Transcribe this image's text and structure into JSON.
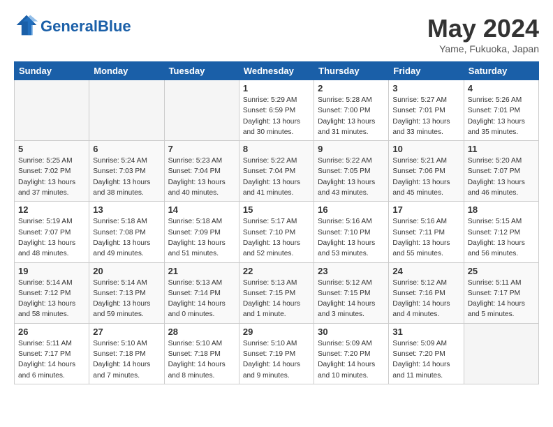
{
  "header": {
    "logo": {
      "general": "General",
      "blue": "Blue"
    },
    "title": "May 2024",
    "location": "Yame, Fukuoka, Japan"
  },
  "weekdays": [
    "Sunday",
    "Monday",
    "Tuesday",
    "Wednesday",
    "Thursday",
    "Friday",
    "Saturday"
  ],
  "weeks": [
    [
      {
        "day": "",
        "info": ""
      },
      {
        "day": "",
        "info": ""
      },
      {
        "day": "",
        "info": ""
      },
      {
        "day": "1",
        "info": "Sunrise: 5:29 AM\nSunset: 6:59 PM\nDaylight: 13 hours\nand 30 minutes."
      },
      {
        "day": "2",
        "info": "Sunrise: 5:28 AM\nSunset: 7:00 PM\nDaylight: 13 hours\nand 31 minutes."
      },
      {
        "day": "3",
        "info": "Sunrise: 5:27 AM\nSunset: 7:01 PM\nDaylight: 13 hours\nand 33 minutes."
      },
      {
        "day": "4",
        "info": "Sunrise: 5:26 AM\nSunset: 7:01 PM\nDaylight: 13 hours\nand 35 minutes."
      }
    ],
    [
      {
        "day": "5",
        "info": "Sunrise: 5:25 AM\nSunset: 7:02 PM\nDaylight: 13 hours\nand 37 minutes."
      },
      {
        "day": "6",
        "info": "Sunrise: 5:24 AM\nSunset: 7:03 PM\nDaylight: 13 hours\nand 38 minutes."
      },
      {
        "day": "7",
        "info": "Sunrise: 5:23 AM\nSunset: 7:04 PM\nDaylight: 13 hours\nand 40 minutes."
      },
      {
        "day": "8",
        "info": "Sunrise: 5:22 AM\nSunset: 7:04 PM\nDaylight: 13 hours\nand 41 minutes."
      },
      {
        "day": "9",
        "info": "Sunrise: 5:22 AM\nSunset: 7:05 PM\nDaylight: 13 hours\nand 43 minutes."
      },
      {
        "day": "10",
        "info": "Sunrise: 5:21 AM\nSunset: 7:06 PM\nDaylight: 13 hours\nand 45 minutes."
      },
      {
        "day": "11",
        "info": "Sunrise: 5:20 AM\nSunset: 7:07 PM\nDaylight: 13 hours\nand 46 minutes."
      }
    ],
    [
      {
        "day": "12",
        "info": "Sunrise: 5:19 AM\nSunset: 7:07 PM\nDaylight: 13 hours\nand 48 minutes."
      },
      {
        "day": "13",
        "info": "Sunrise: 5:18 AM\nSunset: 7:08 PM\nDaylight: 13 hours\nand 49 minutes."
      },
      {
        "day": "14",
        "info": "Sunrise: 5:18 AM\nSunset: 7:09 PM\nDaylight: 13 hours\nand 51 minutes."
      },
      {
        "day": "15",
        "info": "Sunrise: 5:17 AM\nSunset: 7:10 PM\nDaylight: 13 hours\nand 52 minutes."
      },
      {
        "day": "16",
        "info": "Sunrise: 5:16 AM\nSunset: 7:10 PM\nDaylight: 13 hours\nand 53 minutes."
      },
      {
        "day": "17",
        "info": "Sunrise: 5:16 AM\nSunset: 7:11 PM\nDaylight: 13 hours\nand 55 minutes."
      },
      {
        "day": "18",
        "info": "Sunrise: 5:15 AM\nSunset: 7:12 PM\nDaylight: 13 hours\nand 56 minutes."
      }
    ],
    [
      {
        "day": "19",
        "info": "Sunrise: 5:14 AM\nSunset: 7:12 PM\nDaylight: 13 hours\nand 58 minutes."
      },
      {
        "day": "20",
        "info": "Sunrise: 5:14 AM\nSunset: 7:13 PM\nDaylight: 13 hours\nand 59 minutes."
      },
      {
        "day": "21",
        "info": "Sunrise: 5:13 AM\nSunset: 7:14 PM\nDaylight: 14 hours\nand 0 minutes."
      },
      {
        "day": "22",
        "info": "Sunrise: 5:13 AM\nSunset: 7:15 PM\nDaylight: 14 hours\nand 1 minute."
      },
      {
        "day": "23",
        "info": "Sunrise: 5:12 AM\nSunset: 7:15 PM\nDaylight: 14 hours\nand 3 minutes."
      },
      {
        "day": "24",
        "info": "Sunrise: 5:12 AM\nSunset: 7:16 PM\nDaylight: 14 hours\nand 4 minutes."
      },
      {
        "day": "25",
        "info": "Sunrise: 5:11 AM\nSunset: 7:17 PM\nDaylight: 14 hours\nand 5 minutes."
      }
    ],
    [
      {
        "day": "26",
        "info": "Sunrise: 5:11 AM\nSunset: 7:17 PM\nDaylight: 14 hours\nand 6 minutes."
      },
      {
        "day": "27",
        "info": "Sunrise: 5:10 AM\nSunset: 7:18 PM\nDaylight: 14 hours\nand 7 minutes."
      },
      {
        "day": "28",
        "info": "Sunrise: 5:10 AM\nSunset: 7:18 PM\nDaylight: 14 hours\nand 8 minutes."
      },
      {
        "day": "29",
        "info": "Sunrise: 5:10 AM\nSunset: 7:19 PM\nDaylight: 14 hours\nand 9 minutes."
      },
      {
        "day": "30",
        "info": "Sunrise: 5:09 AM\nSunset: 7:20 PM\nDaylight: 14 hours\nand 10 minutes."
      },
      {
        "day": "31",
        "info": "Sunrise: 5:09 AM\nSunset: 7:20 PM\nDaylight: 14 hours\nand 11 minutes."
      },
      {
        "day": "",
        "info": ""
      }
    ]
  ]
}
